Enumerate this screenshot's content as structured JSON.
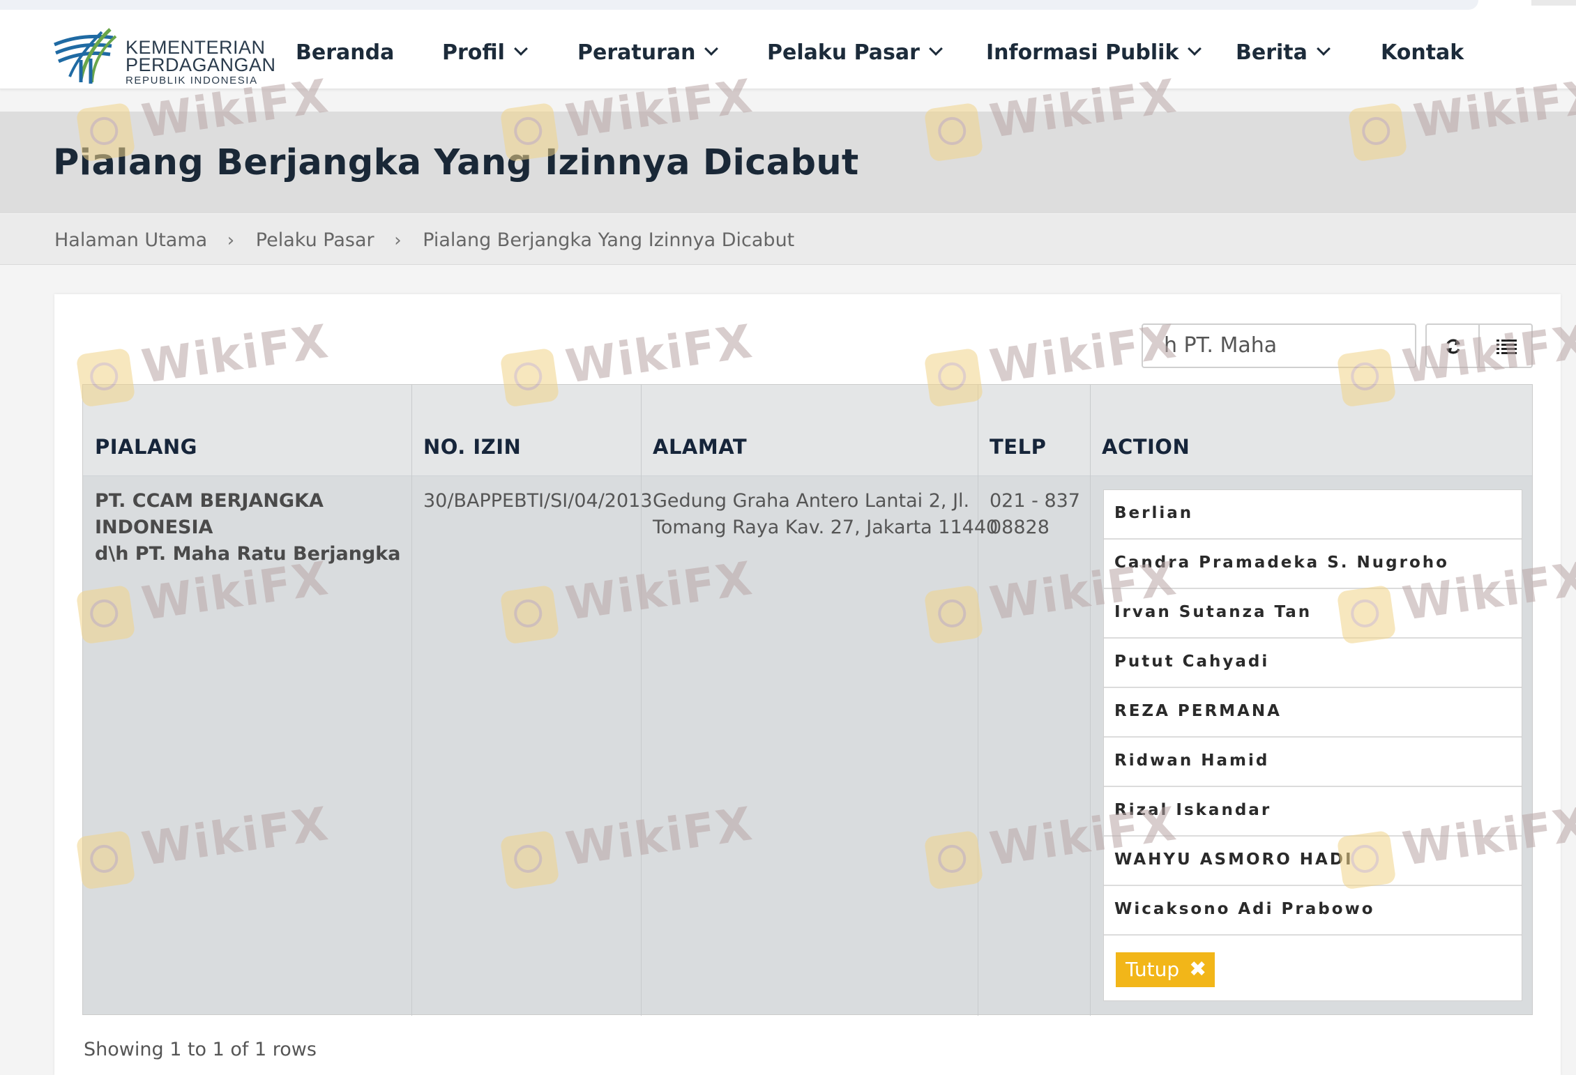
{
  "brand": {
    "line1": "KEMENTERIAN",
    "line2": "PERDAGANGAN",
    "line3": "REPUBLIK INDONESIA"
  },
  "nav": {
    "items": [
      {
        "label": "Beranda",
        "dropdown": false
      },
      {
        "label": "Profil",
        "dropdown": true
      },
      {
        "label": "Peraturan",
        "dropdown": true
      },
      {
        "label": "Pelaku Pasar",
        "dropdown": true
      },
      {
        "label": "Informasi Publik",
        "dropdown": true
      },
      {
        "label": "Berita",
        "dropdown": true
      },
      {
        "label": "Kontak",
        "dropdown": false
      }
    ]
  },
  "page": {
    "title": "Pialang Berjangka Yang Izinnya Dicabut"
  },
  "breadcrumb": [
    "Halaman Utama",
    "Pelaku Pasar",
    "Pialang Berjangka Yang Izinnya Dicabut"
  ],
  "toolbar": {
    "search_value": "h PT. Maha",
    "refresh_icon": "refresh-icon",
    "columns_icon": "list-icon"
  },
  "table": {
    "headers": [
      "PIALANG",
      "NO. IZIN",
      "ALAMAT",
      "TELP",
      "ACTION"
    ],
    "row": {
      "pialang_line1": "PT. CCAM BERJANGKA INDONESIA",
      "pialang_line2": "d\\h PT. Maha Ratu Berjangka",
      "no_izin": "30/BAPPEBTI/SI/04/2013",
      "alamat_line1": "Gedung Graha Antero Lantai 2, Jl.",
      "alamat_line2": "Tomang Raya Kav. 27, Jakarta 11440",
      "telp_line1": "021 - 837",
      "telp_line2": "08828"
    },
    "action_items": [
      "Berlian",
      "Candra Pramadeka S. Nugroho",
      "Irvan Sutanza Tan",
      "Putut Cahyadi",
      "REZA PERMANA",
      "Ridwan Hamid",
      "Rizal Iskandar",
      "WAHYU ASMORO HADI",
      "Wicaksono Adi Prabowo"
    ],
    "close_label": "Tutup"
  },
  "pagination": {
    "summary": "Showing 1 to 1 of 1 rows"
  },
  "watermark": {
    "text": "WikiFX"
  },
  "colors": {
    "accent": "#f2b619",
    "title": "#1a2837",
    "nav_text": "#1c2b3a",
    "band": "#dddddd",
    "logo_blue": "#1f6aa3",
    "logo_green": "#6aa64a"
  }
}
